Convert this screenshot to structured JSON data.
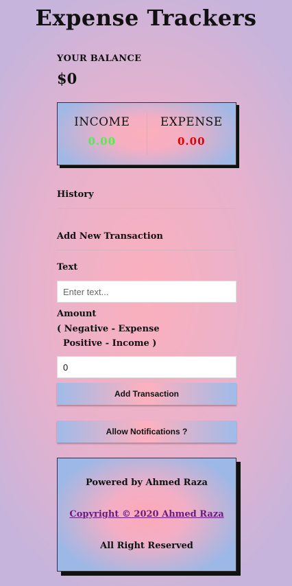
{
  "app": {
    "title": "Expense Trackers"
  },
  "balance": {
    "label": "YOUR BALANCE",
    "value": "$0"
  },
  "summary": {
    "income_label": "INCOME",
    "income_value": "0.00",
    "expense_label": "EXPENSE",
    "expense_value": "0.00"
  },
  "history": {
    "heading": "History"
  },
  "add_transaction": {
    "heading": "Add New Transaction",
    "text_label": "Text",
    "text_placeholder": "Enter text...",
    "amount_label": "Amount",
    "amount_hint_1": "( Negative - Expense",
    "amount_hint_2": "  Positive - Income )",
    "amount_value": "0",
    "submit_label": "Add Transaction"
  },
  "notifications": {
    "button_label": "Allow Notifications ?"
  },
  "footer": {
    "powered_by": "Powered by Ahmed Raza",
    "copyright": "Copyright © 2020 Ahmed Raza",
    "rights": "All Right Reserved"
  },
  "colors": {
    "income": "#4cf04c",
    "expense": "#e00000",
    "link": "#6a1c7e"
  }
}
